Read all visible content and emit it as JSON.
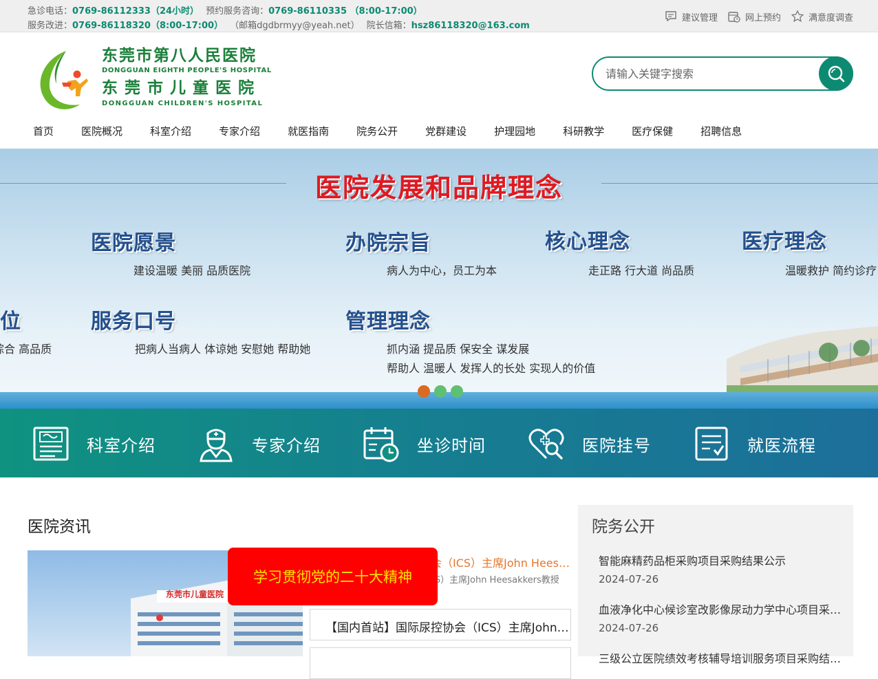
{
  "topbar": {
    "emergency_label": "急诊电话：",
    "emergency_value": "0769-86112333（24小时）",
    "appointment_label": "预约服务咨询：",
    "appointment_value": "0769-86110335 （8:00-17:00）",
    "service_label": "服务改进：",
    "service_value": "0769-86118320（8:00-17:00）",
    "email_note": "（邮箱dgdbrmyy@yeah.net）",
    "director_label": "院长信箱：",
    "director_value": "hsz86118320@163.com",
    "links": [
      {
        "label": "建议管理",
        "icon": "comment-icon"
      },
      {
        "label": "网上预约",
        "icon": "calendar-clock-icon"
      },
      {
        "label": "满意度调查",
        "icon": "star-icon"
      }
    ]
  },
  "logo": {
    "cn1": "东莞市第八人民医院",
    "en1": "DONGGUAN EIGHTH PEOPLE'S HOSPITAL",
    "cn2": "东莞市儿童医院",
    "en2": "DONGGUAN CHILDREN'S HOSPITAL"
  },
  "search": {
    "placeholder": "请输入关键字搜索"
  },
  "nav": [
    "首页",
    "医院概况",
    "科室介绍",
    "专家介绍",
    "就医指南",
    "院务公开",
    "党群建设",
    "护理园地",
    "科研教学",
    "医疗保健",
    "招聘信息"
  ],
  "banner": {
    "title": "医院发展和品牌理念",
    "cat_vision": "医院愿景",
    "desc_vision": "建设温暖  美丽  品质医院",
    "cat_purpose": "办院宗旨",
    "desc_purpose": "病人为中心，员工为本",
    "cat_core": "核心理念",
    "desc_core": "走正路  行大道  尚品质",
    "cat_medical": "医疗理念",
    "desc_medical": "温暖救护  简约诊疗",
    "cat_position": "位",
    "desc_position": "综合  高品质",
    "cat_slogan": "服务口号",
    "desc_slogan": "把病人当病人  体谅她  安慰她  帮助她",
    "cat_mgmt": "管理理念",
    "desc_mgmt1": "抓内涵  提品质  保安全  谋发展",
    "desc_mgmt2": "帮助人  温暖人  发挥人的长处  实现人的价值",
    "slide_count": 3,
    "active_slide": 1
  },
  "services": [
    {
      "label": "科室介绍",
      "icon": "department-icon"
    },
    {
      "label": "专家介绍",
      "icon": "doctor-icon"
    },
    {
      "label": "坐诊时间",
      "icon": "schedule-icon"
    },
    {
      "label": "医院挂号",
      "icon": "heart-search-icon"
    },
    {
      "label": "就医流程",
      "icon": "checklist-icon"
    }
  ],
  "news": {
    "title": "医院资讯",
    "headline": "【国内首站】国际尿控协会（ICS）主席John Heesakkers教授",
    "headline_sub": "【国内首站】国际尿控协会（ICS）主席John Heesakkers教授",
    "items": [
      "【国内首站】国际尿控协会（ICS）主席John Heesakkers教授",
      ""
    ],
    "image_sign": "东莞市儿童医院"
  },
  "popup": {
    "text": "学习贯彻党的二十大精神"
  },
  "notice": {
    "title": "院务公开",
    "items": [
      {
        "title": "智能麻精药品柜采购项目采购结果公示",
        "date": "2024-07-26"
      },
      {
        "title": "血液净化中心候诊室改影像尿动力学中心项目采购结果公示",
        "date": "2024-07-26"
      },
      {
        "title": "三级公立医院绩效考核辅导培训服务项目采购结果公示",
        "date": ""
      }
    ]
  },
  "colors": {
    "brand": "#0d8a72",
    "accent_orange": "#e5762a",
    "banner_title": "#e01921",
    "popup_bg": "#ff0000"
  }
}
